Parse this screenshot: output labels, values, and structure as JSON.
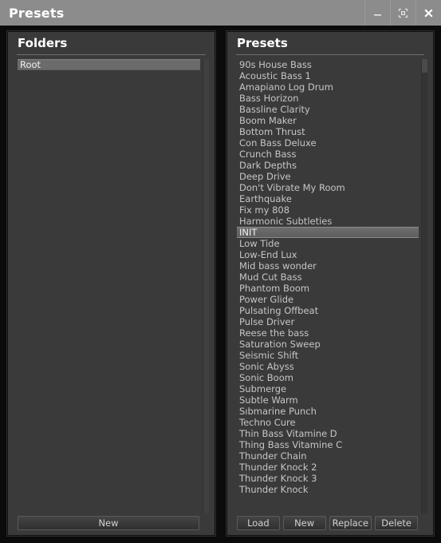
{
  "window": {
    "title": "Presets",
    "controls": [
      {
        "name": "minimize-button",
        "icon": "minimize-icon",
        "label": "—"
      },
      {
        "name": "restore-button",
        "icon": "restore-icon",
        "label": "⧉"
      },
      {
        "name": "close-button",
        "icon": "close-icon",
        "label": "✕"
      }
    ]
  },
  "folders_panel": {
    "header": "Folders",
    "items": [
      {
        "label": "Root",
        "selected": true
      }
    ],
    "buttons": [
      {
        "label": "New"
      }
    ]
  },
  "presets_panel": {
    "header": "Presets",
    "items": [
      {
        "label": "90s House Bass",
        "selected": false
      },
      {
        "label": "Acoustic Bass 1",
        "selected": false
      },
      {
        "label": "Amapiano Log Drum",
        "selected": false
      },
      {
        "label": "Bass Horizon",
        "selected": false
      },
      {
        "label": "Bassline Clarity",
        "selected": false
      },
      {
        "label": "Boom Maker",
        "selected": false
      },
      {
        "label": "Bottom Thrust",
        "selected": false
      },
      {
        "label": "Con Bass Deluxe",
        "selected": false
      },
      {
        "label": "Crunch Bass",
        "selected": false
      },
      {
        "label": "Dark Depths",
        "selected": false
      },
      {
        "label": "Deep Drive",
        "selected": false
      },
      {
        "label": "Don't Vibrate My Room",
        "selected": false
      },
      {
        "label": "Earthquake",
        "selected": false
      },
      {
        "label": "Fix my 808",
        "selected": false
      },
      {
        "label": "Harmonic Subtleties",
        "selected": false
      },
      {
        "label": "INIT",
        "selected": true
      },
      {
        "label": "Low Tide",
        "selected": false
      },
      {
        "label": "Low-End Lux",
        "selected": false
      },
      {
        "label": "Mid bass wonder",
        "selected": false
      },
      {
        "label": "Mud Cut Bass",
        "selected": false
      },
      {
        "label": "Phantom Boom",
        "selected": false
      },
      {
        "label": "Power Glide",
        "selected": false
      },
      {
        "label": "Pulsating Offbeat",
        "selected": false
      },
      {
        "label": "Pulse Driver",
        "selected": false
      },
      {
        "label": "Reese the bass",
        "selected": false
      },
      {
        "label": "Saturation Sweep",
        "selected": false
      },
      {
        "label": "Seismic Shift",
        "selected": false
      },
      {
        "label": "Sonic Abyss",
        "selected": false
      },
      {
        "label": "Sonic Boom",
        "selected": false
      },
      {
        "label": "Submerge",
        "selected": false
      },
      {
        "label": "Subtle Warm",
        "selected": false
      },
      {
        "label": "Sıbmarine Punch",
        "selected": false
      },
      {
        "label": "Techno Cure",
        "selected": false
      },
      {
        "label": "Thin Bass Vitamine D",
        "selected": false
      },
      {
        "label": "Thing Bass Vitamine C",
        "selected": false
      },
      {
        "label": "Thunder Chain",
        "selected": false
      },
      {
        "label": "Thunder Knock 2",
        "selected": false
      },
      {
        "label": "Thunder Knock 3",
        "selected": false
      },
      {
        "label": "Thunder Knock",
        "selected": false
      }
    ],
    "buttons": [
      {
        "label": "Load"
      },
      {
        "label": "New"
      },
      {
        "label": "Replace"
      },
      {
        "label": "Delete"
      }
    ]
  },
  "colors": {
    "titlebar": "#8c8c8c",
    "panel_bg": "#3a3a3a",
    "window_bg": "#0b0b0b",
    "text": "#c6c6c6",
    "selection": "#6b6b6b"
  }
}
